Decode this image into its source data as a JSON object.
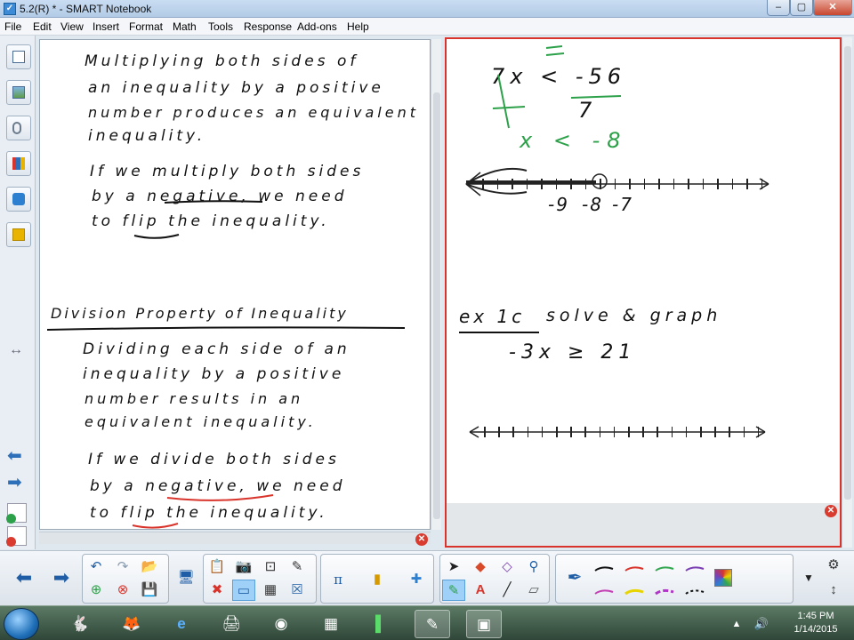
{
  "window": {
    "title": "5.2(R) * - SMART Notebook",
    "app_icon": "smart-notebook-icon",
    "controls": [
      "minimize",
      "maximize",
      "close"
    ]
  },
  "menu": [
    "File",
    "Edit",
    "View",
    "Insert",
    "Format",
    "Math",
    "Tools",
    "Response",
    "Add-ons",
    "Help"
  ],
  "sidebar": [
    "page-sorter-icon",
    "gallery-icon",
    "attachments-icon",
    "properties-icon",
    "add-ons-icon",
    "response-icon"
  ],
  "left_page": {
    "lines": [
      "Multiplying both sides of",
      "an inequality by a positive",
      "number produces an equivalent",
      "inequality.",
      "If we multiply both sides",
      "by a negative, we need",
      "to flip the inequality.",
      "Division Property of Inequality",
      "Dividing each side of an",
      "inequality by a positive",
      "number results in an",
      "equivalent inequality.",
      "If we divide both sides",
      "by a negative, we need",
      "to flip the inequality."
    ]
  },
  "right_page": {
    "work": [
      "7x < -56",
      "7",
      "x < -8"
    ],
    "number_line_labels": [
      "-9",
      "-8",
      "-7"
    ],
    "example_label": "ex 1c",
    "example_task": "solve & graph",
    "example_problem": "-3x ≥ 21"
  },
  "toolbar": {
    "nav": [
      "previous-page-icon",
      "next-page-icon"
    ],
    "math_symbol": "π",
    "pen_colors": [
      "#111111",
      "#d9342b",
      "#33a650",
      "#7a3fb3",
      "#c33fb3",
      "#e8d400",
      "#b235c9",
      "#111111"
    ]
  },
  "taskbar": {
    "apps": [
      "start-orb",
      "bunny-icon",
      "firefox-icon",
      "internet-explorer-icon",
      "device-icon",
      "music-player-icon",
      "calculator-icon",
      "chart-icon",
      "smart-notebook-task-icon",
      "document-task-icon"
    ],
    "time": "1:45 PM",
    "date": "1/14/2015"
  },
  "colors": {
    "accent_red": "#d9342b",
    "ink_green": "#2da14a",
    "ink_red": "#d9342b"
  }
}
